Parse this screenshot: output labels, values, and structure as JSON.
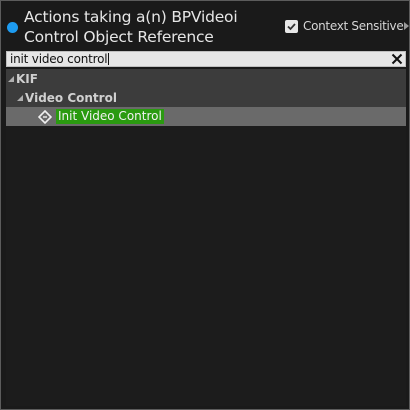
{
  "header": {
    "title": "Actions taking a(n) BPVideoi Control Object Reference",
    "context_sensitive_label": "Context Sensitive",
    "context_sensitive_checked": true
  },
  "search": {
    "value": "init video control"
  },
  "tree": {
    "categories": [
      {
        "label": "KIF",
        "subcategories": [
          {
            "label": "Video Control",
            "items": [
              {
                "label": "Init Video Control",
                "selected": true
              }
            ]
          }
        ]
      }
    ]
  },
  "colors": {
    "pin": "#1d9bf0",
    "highlight": "#2a9a10"
  },
  "icons": [
    "pin-icon",
    "checkbox-check-icon",
    "arrow-right-icon",
    "close-icon",
    "expand-icon",
    "function-node-icon"
  ]
}
